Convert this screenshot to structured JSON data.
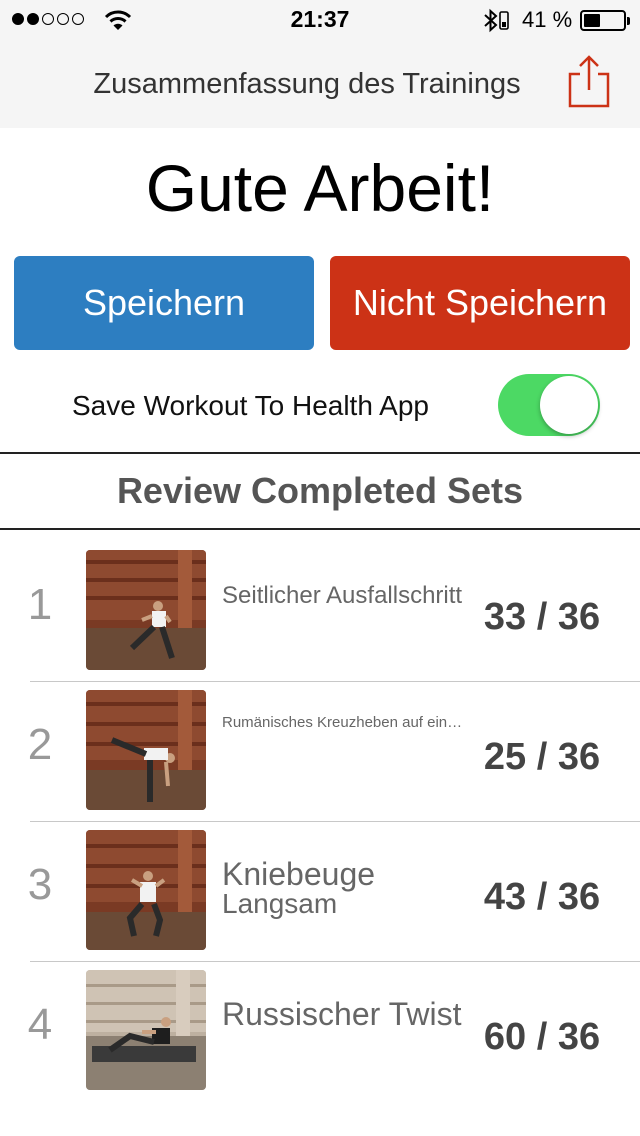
{
  "status_bar": {
    "time": "21:37",
    "battery_percent": "41 %",
    "signal_bars_filled": 2,
    "signal_bars_total": 5,
    "battery_level": 0.41
  },
  "nav": {
    "title": "Zusammenfassung des Trainings",
    "share_icon": "share-icon"
  },
  "headline": "Gute Arbeit!",
  "buttons": {
    "save": "Speichern",
    "dont_save": "Nicht Speichern"
  },
  "health": {
    "label": "Save Workout To Health App",
    "enabled": true
  },
  "section_title": "Review Completed Sets",
  "colors": {
    "save_button": "#2d7ec1",
    "dont_save_button": "#cc3216",
    "toggle_on": "#4cd964"
  },
  "exercises": [
    {
      "index": "1",
      "name": "Seitlicher Ausfallschritt",
      "sub": "",
      "count": "33 / 36"
    },
    {
      "index": "2",
      "name": "Rumänisches Kreuzheben auf ein…",
      "sub": "",
      "count": "25 / 36"
    },
    {
      "index": "3",
      "name": "Kniebeuge",
      "sub": "Langsam",
      "count": "43 / 36"
    },
    {
      "index": "4",
      "name": "Russischer Twist",
      "sub": "",
      "count": "60 / 36"
    }
  ]
}
